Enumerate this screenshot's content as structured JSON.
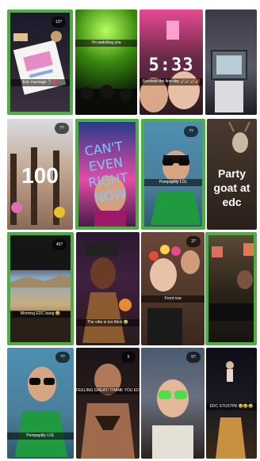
{
  "tiles": [
    {
      "badge": "13?",
      "caption": "Edc marriage 💍❤️"
    },
    {
      "badge": "",
      "caption": "I'm watching you"
    },
    {
      "badge": "",
      "clock": "5:33",
      "caption": "Survived the first day 🎉🎉🎉🎉"
    },
    {
      "badge": "",
      "caption": ""
    },
    {
      "badge": "??",
      "big_text": "100",
      "caption": ""
    },
    {
      "badge": "",
      "scrawl": "CAN'T EVEN RIGHT NOW",
      "caption": ""
    },
    {
      "badge": "??",
      "caption": "Pompaplity LOL"
    },
    {
      "badge": "",
      "big_text": "Party goat at edc",
      "caption": ""
    },
    {
      "badge": "45?",
      "caption": "Morning EDC bang 😀"
    },
    {
      "badge": "",
      "caption": "The vibe is too thick 😂"
    },
    {
      "badge": "3?",
      "caption": "Front row"
    },
    {
      "badge": "",
      "caption": ""
    },
    {
      "badge": "??",
      "caption": "Pompaplity LOL"
    },
    {
      "badge": "5",
      "caption": "FEELING GREAT! THANK YOU EDC"
    },
    {
      "badge": "5?",
      "caption": ""
    },
    {
      "badge": "",
      "caption": "EDC STUSTIN! 😂😂😂"
    }
  ]
}
